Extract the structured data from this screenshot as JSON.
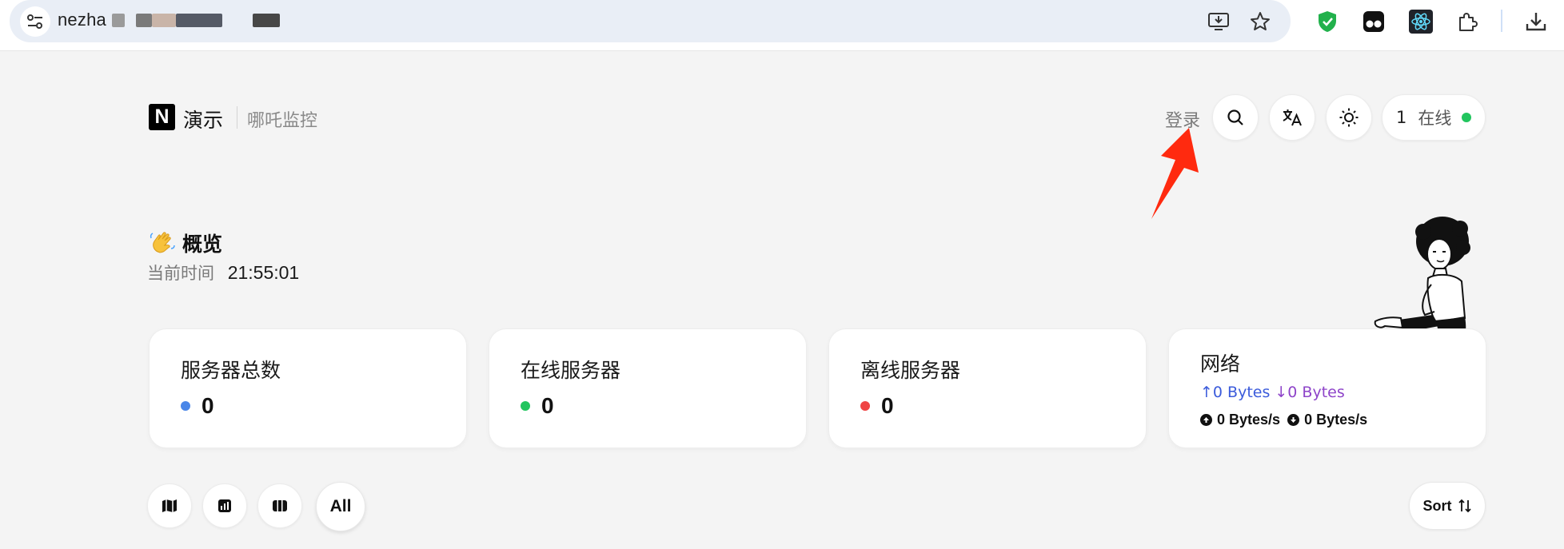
{
  "browser": {
    "url": "nezha",
    "icons": [
      "site-settings-icon",
      "install-app-icon",
      "bookmark-star-icon",
      "shield-extension-icon",
      "tampermonkey-extension-icon",
      "react-devtools-icon",
      "extensions-puzzle-icon",
      "downloads-icon"
    ]
  },
  "header": {
    "logo_letter": "N",
    "brand": "演示",
    "subtitle": "哪吒监控",
    "login": "登录",
    "online_count": "1",
    "online_label": "在线",
    "online_color": "#22c55e"
  },
  "overview": {
    "title": "概览",
    "time_label": "当前时间",
    "time_value": "21:55:01"
  },
  "stats": {
    "total": {
      "title": "服务器总数",
      "value": "0",
      "color": "#4a86e8"
    },
    "online": {
      "title": "在线服务器",
      "value": "0",
      "color": "#22c55e"
    },
    "offline": {
      "title": "离线服务器",
      "value": "0",
      "color": "#ef4444"
    },
    "network": {
      "title": "网络",
      "upload_total": "↑0 Bytes",
      "download_total": "↓0 Bytes",
      "upload_speed": "0 Bytes/s",
      "download_speed": "0 Bytes/s"
    }
  },
  "toolbar": {
    "view_icons": [
      "map-view-icon",
      "chart-view-icon",
      "grid-columns-icon"
    ],
    "all_label": "All",
    "sort_label": "Sort"
  }
}
